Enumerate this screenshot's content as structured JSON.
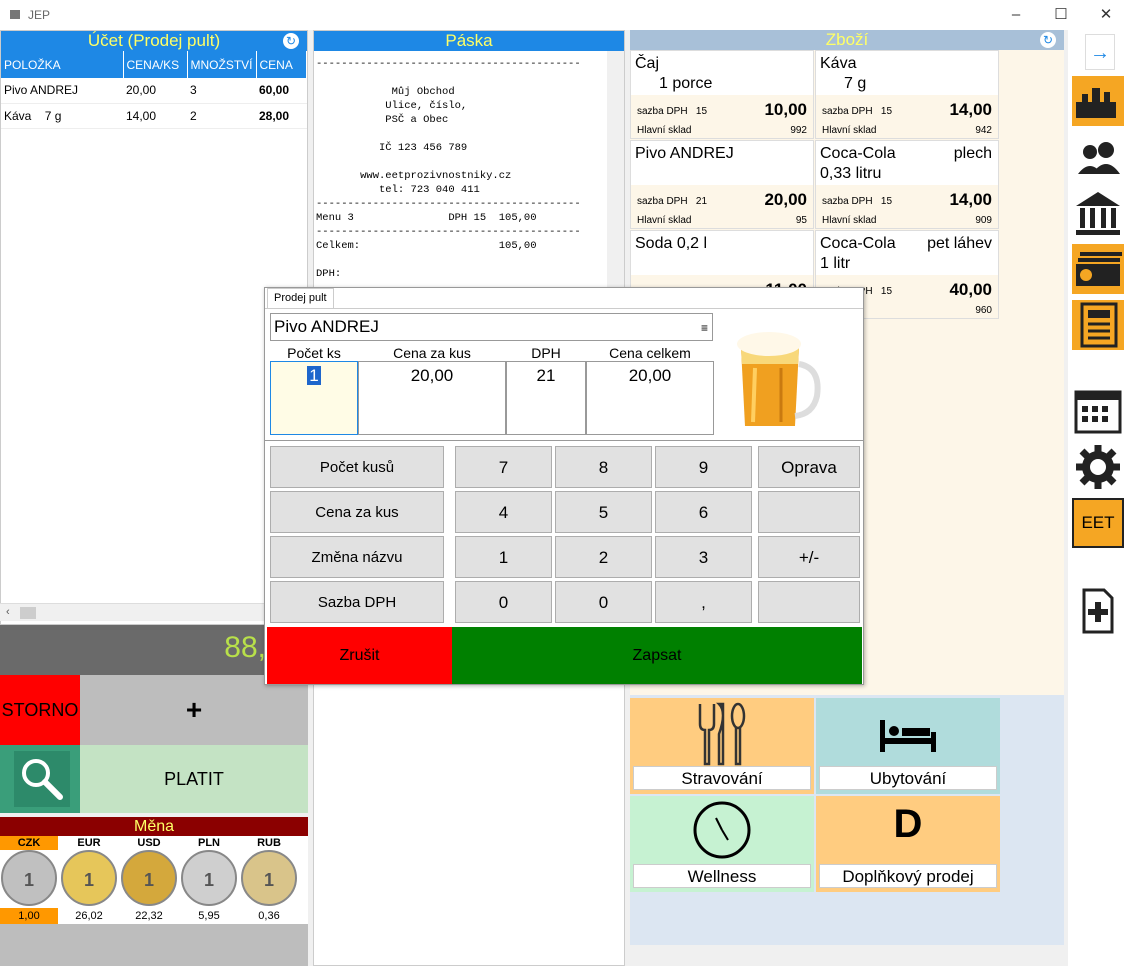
{
  "window": {
    "title": "JEP"
  },
  "ucet": {
    "title": "Účet (Prodej pult)",
    "columns": [
      "POLOŽKA",
      "CENA/KS",
      "MNOŽSTVÍ",
      "CENA"
    ],
    "rows": [
      {
        "name": "Pivo ANDREJ",
        "unit": "",
        "price": "20,00",
        "qty": "3",
        "total": "60,00"
      },
      {
        "name": "Káva",
        "unit": "7 g",
        "price": "14,00",
        "qty": "2",
        "total": "28,00"
      }
    ],
    "total": "88,"
  },
  "actions": {
    "storno": "STORNO",
    "plus": "+",
    "platit": "PLATIT"
  },
  "mena": {
    "title": "Měna",
    "currencies": [
      {
        "code": "CZK",
        "rate": "1,00",
        "coin_label": "1"
      },
      {
        "code": "EUR",
        "rate": "26,02",
        "coin_label": "1"
      },
      {
        "code": "USD",
        "rate": "22,32",
        "coin_label": "1"
      },
      {
        "code": "PLN",
        "rate": "5,95",
        "coin_label": "1"
      },
      {
        "code": "RUB",
        "rate": "0,36",
        "coin_label": "1"
      }
    ]
  },
  "paska": {
    "title": "Páska",
    "lines": "------------------------------------------\n\n            Můj Obchod\n           Ulice, číslo,\n           PSČ a Obec\n\n          IČ 123 456 789\n\n       www.eetprozivnostniky.cz\n          tel: 723 040 411\n------------------------------------------\nMenu 3               DPH 15  105,00\n------------------------------------------\nCelkem:                      105,00\n\nDPH:"
  },
  "zbozi": {
    "title": "Zboží",
    "products": [
      {
        "name": "Čaj",
        "name2": "",
        "sub": "1 porce",
        "vat_label": "sazba DPH",
        "vat": "15",
        "price": "10,00",
        "warehouse": "Hlavní sklad",
        "count": "992"
      },
      {
        "name": "Káva",
        "name2": "",
        "sub": "7 g",
        "vat_label": "sazba DPH",
        "vat": "15",
        "price": "14,00",
        "warehouse": "Hlavní sklad",
        "count": "942"
      },
      {
        "name": "Pivo ANDREJ",
        "name2": "",
        "sub": "",
        "vat_label": "sazba DPH",
        "vat": "21",
        "price": "20,00",
        "warehouse": "Hlavní sklad",
        "count": "95"
      },
      {
        "name": "Coca-Cola",
        "name2": "plech",
        "sub": "0,33 litru",
        "vat_label": "sazba DPH",
        "vat": "15",
        "price": "14,00",
        "warehouse": "Hlavní sklad",
        "count": "909"
      },
      {
        "name": "Soda 0,2 l",
        "name2": "",
        "sub": "",
        "vat_label": "",
        "vat": "",
        "price": "11,00",
        "warehouse": "",
        "count": ""
      },
      {
        "name": "Coca-Cola",
        "name2": "pet láhev",
        "sub": "1 litr",
        "vat_label": "sazba DPH",
        "vat": "15",
        "price": "40,00",
        "warehouse": "sklad",
        "count": "960"
      }
    ],
    "categories": [
      {
        "label": "Stravování",
        "color": "#ffcc80"
      },
      {
        "label": "Ubytování",
        "color": "#b0dcdc"
      },
      {
        "label": "Wellness",
        "color": "#c6f2d2"
      },
      {
        "label": "Doplňkový prodej",
        "color": "#ffcc80"
      }
    ]
  },
  "toolbar": {
    "eet_label": "EET"
  },
  "dialog": {
    "tab": "Prodej pult",
    "product_name": "Pivo ANDREJ",
    "col_qty": "Počet ks",
    "col_unit_price": "Cena za kus",
    "col_vat": "DPH",
    "col_total": "Cena celkem",
    "qty": "1",
    "unit_price": "20,00",
    "vat": "21",
    "total": "20,00",
    "func_buttons": [
      "Počet kusů",
      "Cena za kus",
      "Změna názvu",
      "Sazba DPH"
    ],
    "keys": [
      "7",
      "8",
      "9",
      "Oprava",
      "4",
      "5",
      "6",
      "",
      "1",
      "2",
      "3",
      "+/-",
      "0",
      "0",
      ",",
      ""
    ],
    "cancel": "Zrušit",
    "confirm": "Zapsat"
  }
}
